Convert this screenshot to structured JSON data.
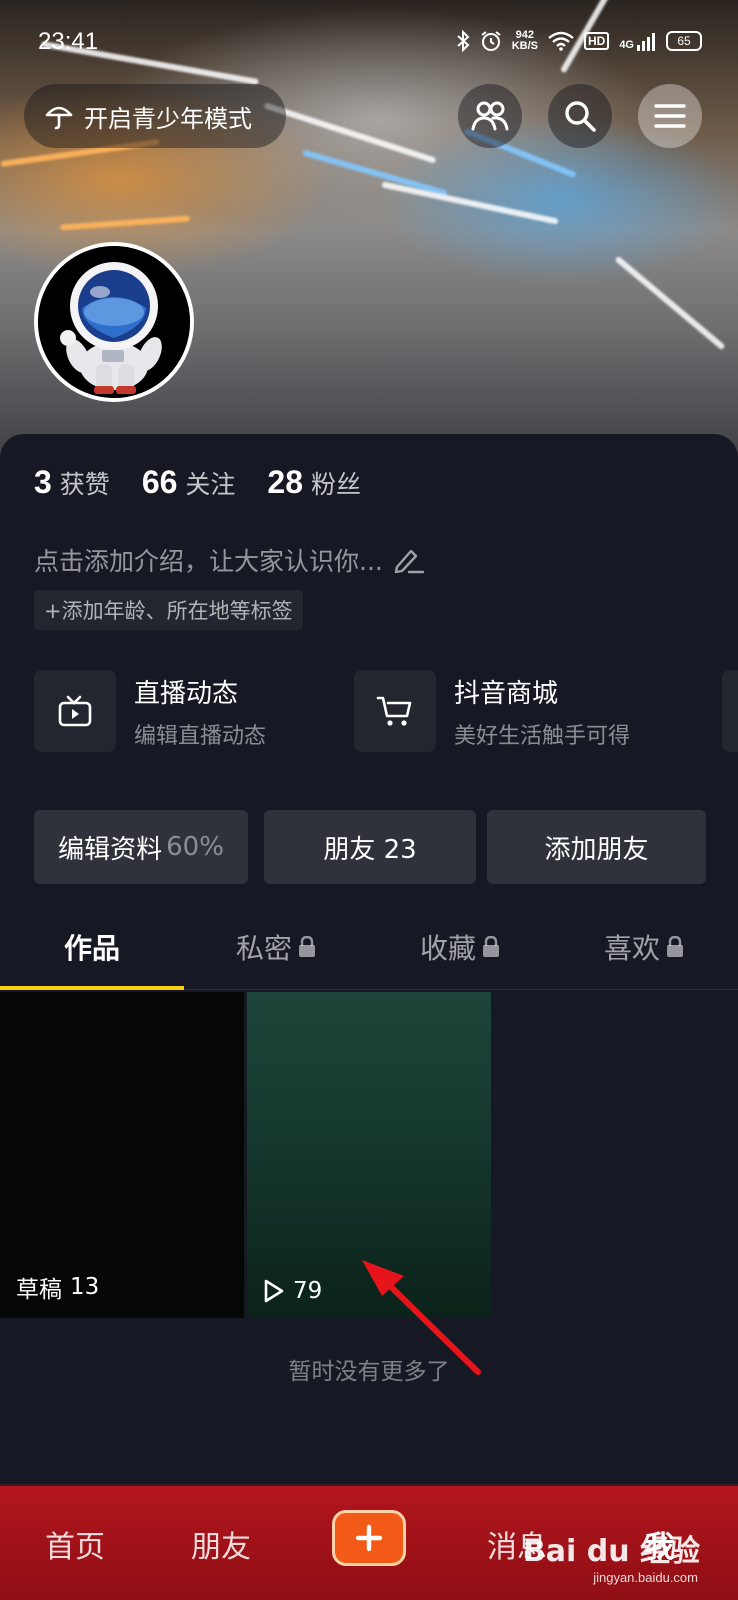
{
  "status_bar": {
    "time": "23:41",
    "net_speed_value": "942",
    "net_speed_unit": "KB/S",
    "hd_label": "HD",
    "signal_label": "4G",
    "battery": "65"
  },
  "header": {
    "teen_mode_label": "开启青少年模式"
  },
  "profile": {
    "stats": [
      {
        "value": "3",
        "label": "获赞"
      },
      {
        "value": "66",
        "label": "关注"
      },
      {
        "value": "28",
        "label": "粉丝"
      }
    ],
    "intro_placeholder": "点击添加介绍，让大家认识你...",
    "add_tags_label": "+添加年龄、所在地等标签"
  },
  "entries": [
    {
      "title": "直播动态",
      "subtitle": "编辑直播动态",
      "icon": "tv-icon"
    },
    {
      "title": "抖音商城",
      "subtitle": "美好生活触手可得",
      "icon": "cart-icon"
    }
  ],
  "actions": {
    "edit_profile": "编辑资料",
    "edit_profile_pct": "60%",
    "friends": "朋友 23",
    "add_friends": "添加朋友"
  },
  "tabs": [
    {
      "label": "作品",
      "locked": false
    },
    {
      "label": "私密",
      "locked": true
    },
    {
      "label": "收藏",
      "locked": true
    },
    {
      "label": "喜欢",
      "locked": true
    }
  ],
  "grid": {
    "draft_label": "草稿",
    "draft_count": "13",
    "video_plays": "79"
  },
  "no_more_text": "暂时没有更多了",
  "bottom_nav": {
    "home": "首页",
    "friends": "朋友",
    "messages": "消息",
    "me": "我",
    "watermark": "Bai du 经验",
    "watermark_url": "jingyan.baidu.com"
  },
  "colors": {
    "background": "#161823",
    "tab_underline": "#face15",
    "plus_button": "#f35a17",
    "bottom_nav": "#b3161d",
    "annotation_arrow": "#e8141c"
  }
}
